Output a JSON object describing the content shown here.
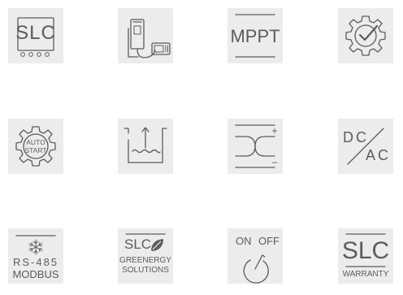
{
  "icons": [
    {
      "id": "slc-display",
      "label": "SLC"
    },
    {
      "id": "remote-display",
      "label": ""
    },
    {
      "id": "mppt",
      "label": "MPPT"
    },
    {
      "id": "gear-check",
      "label": ""
    },
    {
      "id": "auto-start",
      "label_line1": "AUTO",
      "label_line2": "START"
    },
    {
      "id": "water-level",
      "label": ""
    },
    {
      "id": "crossover",
      "plus": "+",
      "minus": "–"
    },
    {
      "id": "dc-ac",
      "label_top": "DC",
      "label_bottom": "AC"
    },
    {
      "id": "rs485-modbus",
      "label_line1": "RS-485",
      "label_line2": "MODBUS"
    },
    {
      "id": "slc-greenergy",
      "label_top": "SLC",
      "label_line1": "GREENERGY",
      "label_line2": "SOLUTIONS"
    },
    {
      "id": "on-off",
      "label_on": "ON",
      "label_off": "OFF"
    },
    {
      "id": "slc-warranty",
      "label_top": "SLC",
      "label_bottom": "WARRANTY"
    }
  ],
  "colors": {
    "tile_background": "#ececec",
    "icon_stroke": "#5c5c5c",
    "page_background": "#ffffff"
  }
}
